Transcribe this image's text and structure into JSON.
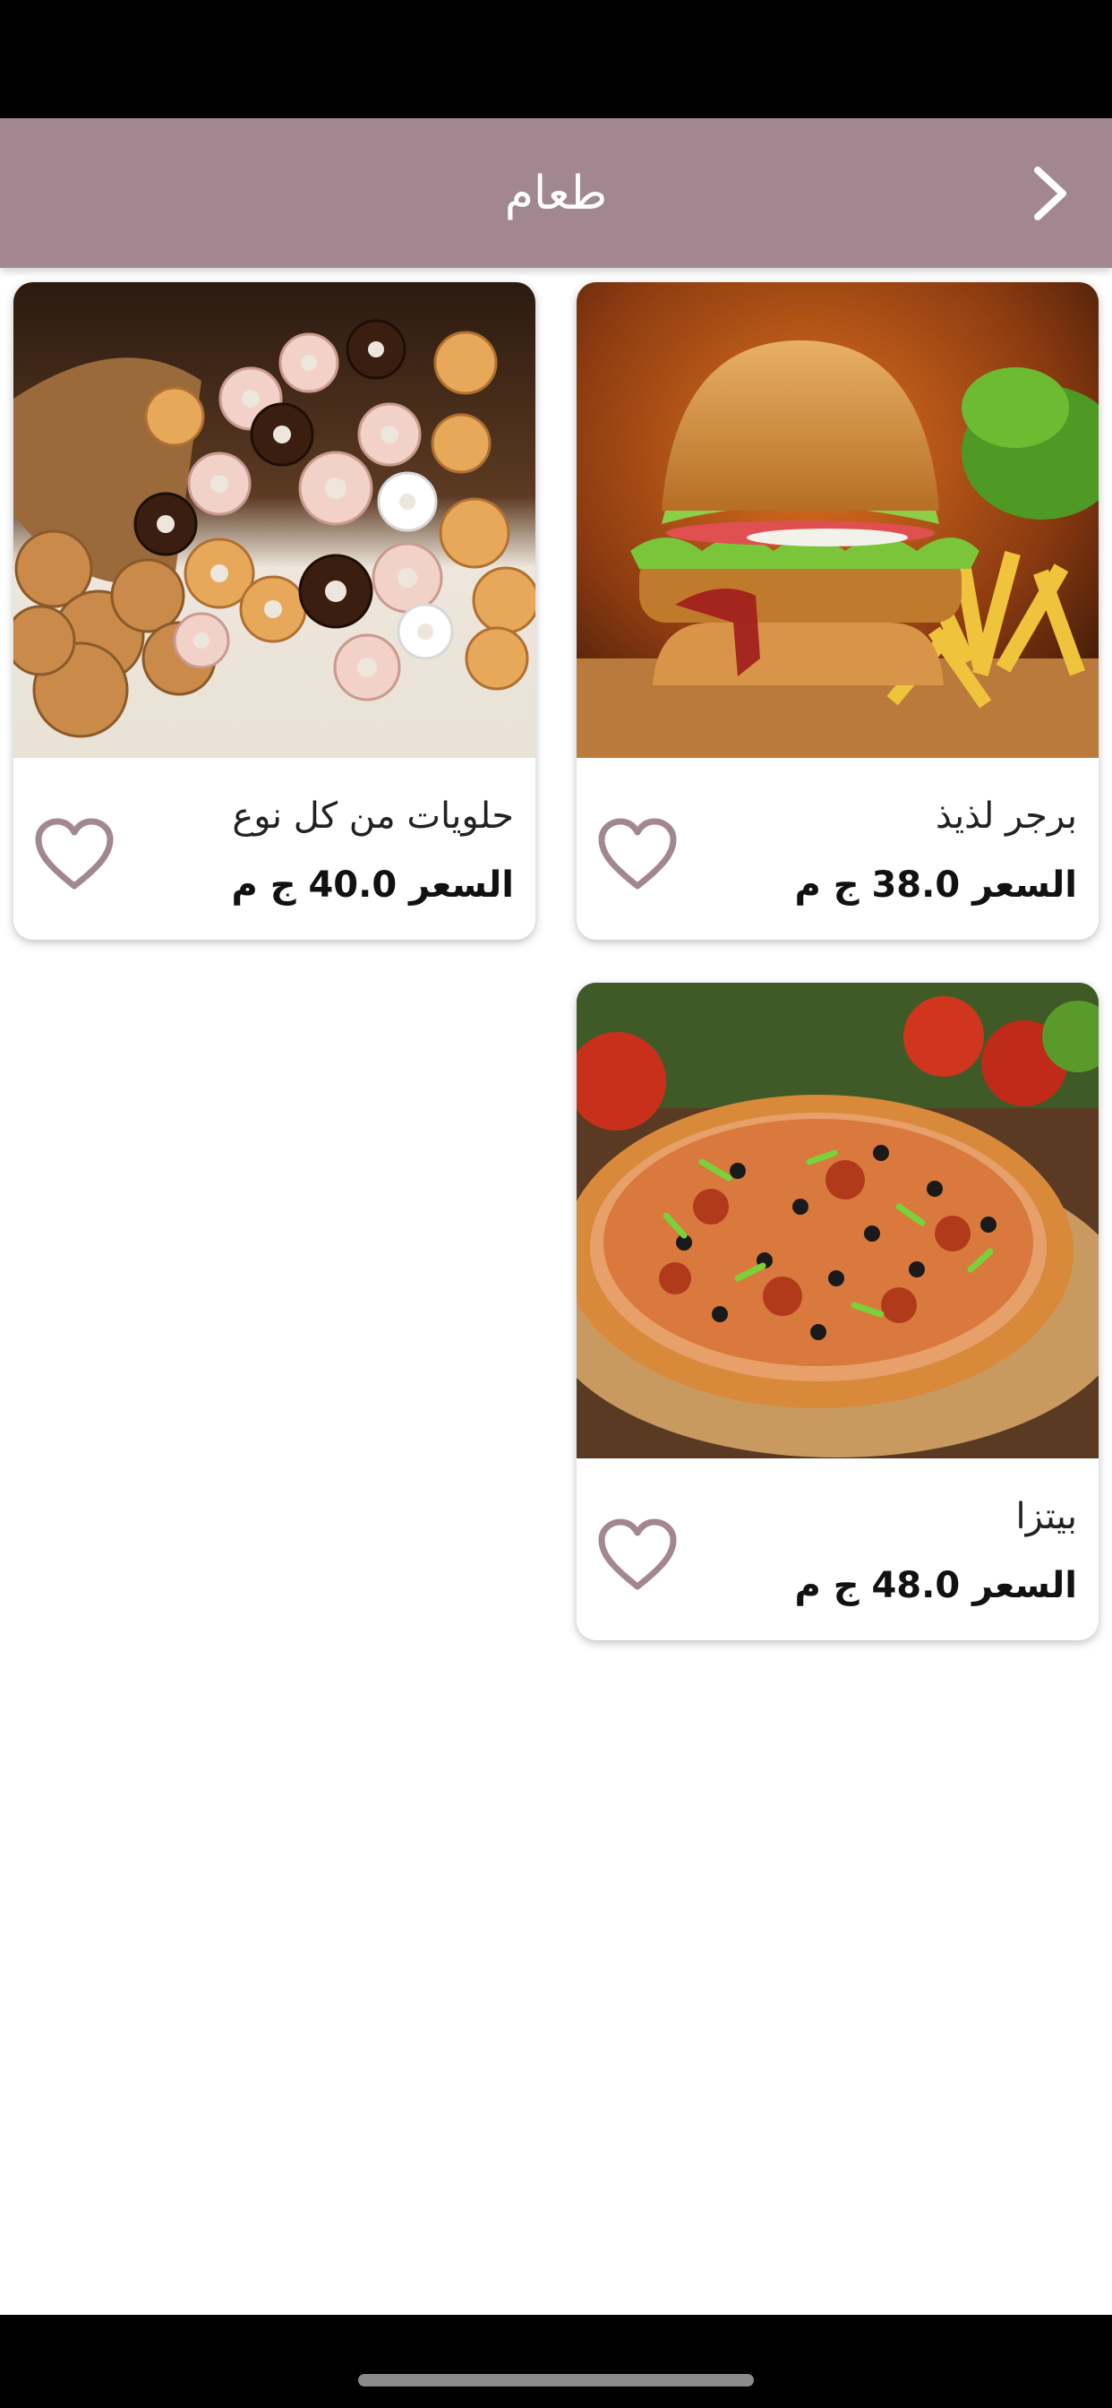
{
  "app_bar": {
    "title": "طعام",
    "back_icon": "chevron-right-icon",
    "color": "#a38790"
  },
  "products": [
    {
      "title": "برجر لذيذ",
      "price": "السعر 38.0 ج م",
      "image": "burger-and-fries-photo",
      "favorite": false
    },
    {
      "title": "حلويات من كل نوع",
      "price": "السعر 40.0 ج م",
      "image": "donuts-and-cookies-photo",
      "favorite": false
    },
    {
      "title": "بيتزا",
      "price": "السعر 48.0 ج م",
      "image": "pizza-photo",
      "favorite": false
    }
  ],
  "favorite_icon": "heart-outline-icon",
  "accent_color": "#a38790"
}
